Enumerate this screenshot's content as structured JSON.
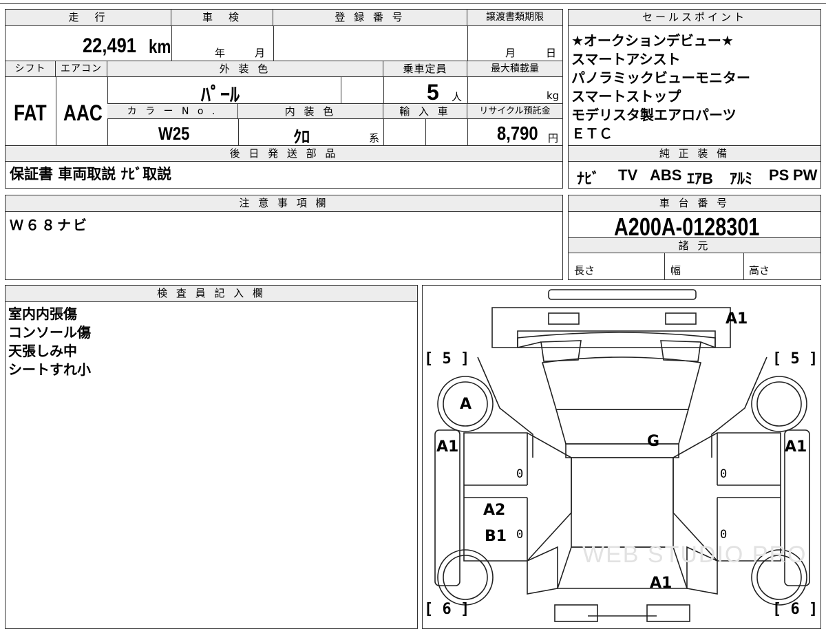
{
  "headers": {
    "mileage": "走　行",
    "inspection": "車　検",
    "registration_no": "登 録 番 号",
    "transfer_deadline": "譲渡書類期限",
    "sales_points": "セールスポイント",
    "shift": "シフト",
    "aircon": "エアコン",
    "exterior_color": "外 装 色",
    "capacity": "乗車定員",
    "max_load": "最大積載量",
    "color_no": "カ ラ ー N o .",
    "interior_color": "内 装 色",
    "import": "輸 入 車",
    "recycle_fee": "リサイクル預託金",
    "later_parts": "後 日 発 送 部 品",
    "genuine_equipment": "純 正 装 備",
    "notes": "注 意 事 項 欄",
    "chassis_no": "車 台 番 号",
    "specs": "諸 元",
    "inspector_notes": "検 査 員 記 入 欄"
  },
  "values": {
    "mileage": "22,491",
    "mileage_unit": "km",
    "inspection_year_unit": "年",
    "inspection_month_unit": "月",
    "deadline_month_unit": "月",
    "deadline_day_unit": "日",
    "shift": "FAT",
    "aircon": "AAC",
    "exterior_color": "ﾊﾟｰﾙ",
    "capacity": "5",
    "capacity_unit": "人",
    "max_load_unit": "kg",
    "color_no": "W25",
    "interior_color": "ｸﾛ",
    "interior_suffix": "系",
    "recycle_fee": "8,790",
    "recycle_unit": "円",
    "later_parts": "保証書 車両取説 ﾅﾋﾞ取説",
    "chassis_no": "A200A-0128301",
    "spec_length": "長さ",
    "spec_width": "幅",
    "spec_height": "高さ"
  },
  "sales_points": [
    "★オークションデビュー★",
    "スマートアシスト",
    "パノラミックビューモニター",
    "スマートストップ",
    "モデリスタ製エアロパーツ",
    "ＥＴＣ"
  ],
  "equipment": [
    "ﾅﾋﾞ",
    "TV",
    "ABS",
    "ｴｱB",
    "ｱﾙﾐ",
    "PS",
    "PW"
  ],
  "notes": "Ｗ６８ナビ",
  "inspector_lines": [
    "室内内張傷",
    "コンソール傷",
    "天張しみ中",
    "シートすれ小"
  ],
  "diagram": {
    "marks": {
      "rear_top": "A1",
      "left_front_wheel": "A",
      "left_side": "A1",
      "right_side": "A1",
      "roof": "G",
      "left_rear_door_1": "A2",
      "left_rear_door_2": "B1",
      "front_bottom": "A1"
    },
    "brackets": {
      "tl": "[ 5 ]",
      "tr": "[ 5 ]",
      "bl": "[ 6 ]",
      "br": "[ 6 ]"
    },
    "zeros": [
      "0",
      "0",
      "0",
      "0"
    ],
    "watermark": "WEB STUDIO PRO"
  }
}
